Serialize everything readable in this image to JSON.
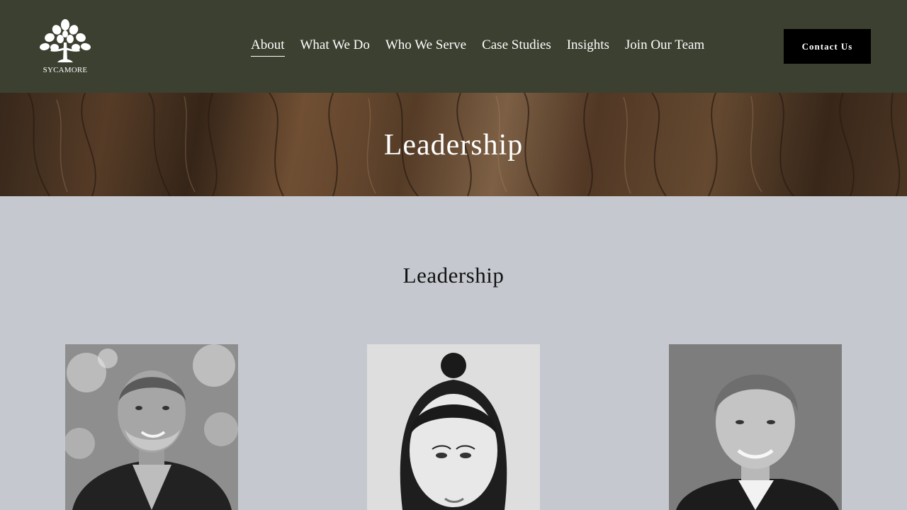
{
  "brand": {
    "logo_text": "SYCAMORE",
    "logo_icon": "tree-icon"
  },
  "nav": {
    "items": [
      {
        "label": "About",
        "active": true
      },
      {
        "label": "What We Do",
        "active": false
      },
      {
        "label": "Who We Serve",
        "active": false
      },
      {
        "label": "Case Studies",
        "active": false
      },
      {
        "label": "Insights",
        "active": false
      },
      {
        "label": "Join Our Team",
        "active": false
      }
    ]
  },
  "header": {
    "contact_label": "Contact Us"
  },
  "hero": {
    "title": "Leadership"
  },
  "section": {
    "title": "Leadership"
  },
  "colors": {
    "header_bg": "#3b4030",
    "page_bg": "#c5c9cf",
    "button_bg": "#000000",
    "text_light": "#ffffff"
  }
}
